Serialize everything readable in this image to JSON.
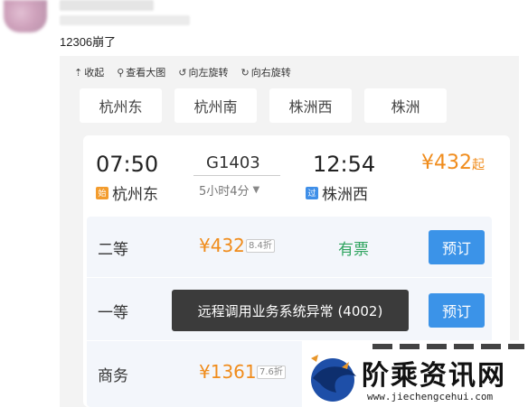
{
  "post": {
    "text": "12306崩了"
  },
  "toolbar": {
    "collapse": "收起",
    "view_large": "查看大图",
    "rotate_left": "向左旋转",
    "rotate_right": "向右旋转"
  },
  "stations_tabs": [
    "杭州东",
    "杭州南",
    "株洲西",
    "株洲"
  ],
  "train": {
    "dep_time": "07:50",
    "arr_time": "12:54",
    "number": "G1403",
    "duration": "5小时4分",
    "dep_station": "杭州东",
    "arr_station": "株洲西",
    "dep_badge": "始",
    "arr_badge": "过",
    "price": "¥432",
    "price_suffix": "起"
  },
  "seats": [
    {
      "name": "二等",
      "price": "¥432",
      "discount": "8.4折",
      "availability": "有票",
      "book": "预订"
    },
    {
      "name": "一等",
      "price": "",
      "discount": "",
      "availability": "",
      "book": "预订"
    },
    {
      "name": "商务",
      "price": "¥1361",
      "discount": "7.6折",
      "availability": "",
      "book": ""
    }
  ],
  "toast": "远程调用业务系统异常 (4002)",
  "watermark": {
    "title": "阶乘资讯网",
    "url": "www.jiechengcehui.com"
  },
  "colors": {
    "price_orange": "#f08c1c",
    "book_blue": "#3b93e8",
    "available_green": "#2fa45f",
    "toast_bg": "#3b3b3b"
  }
}
